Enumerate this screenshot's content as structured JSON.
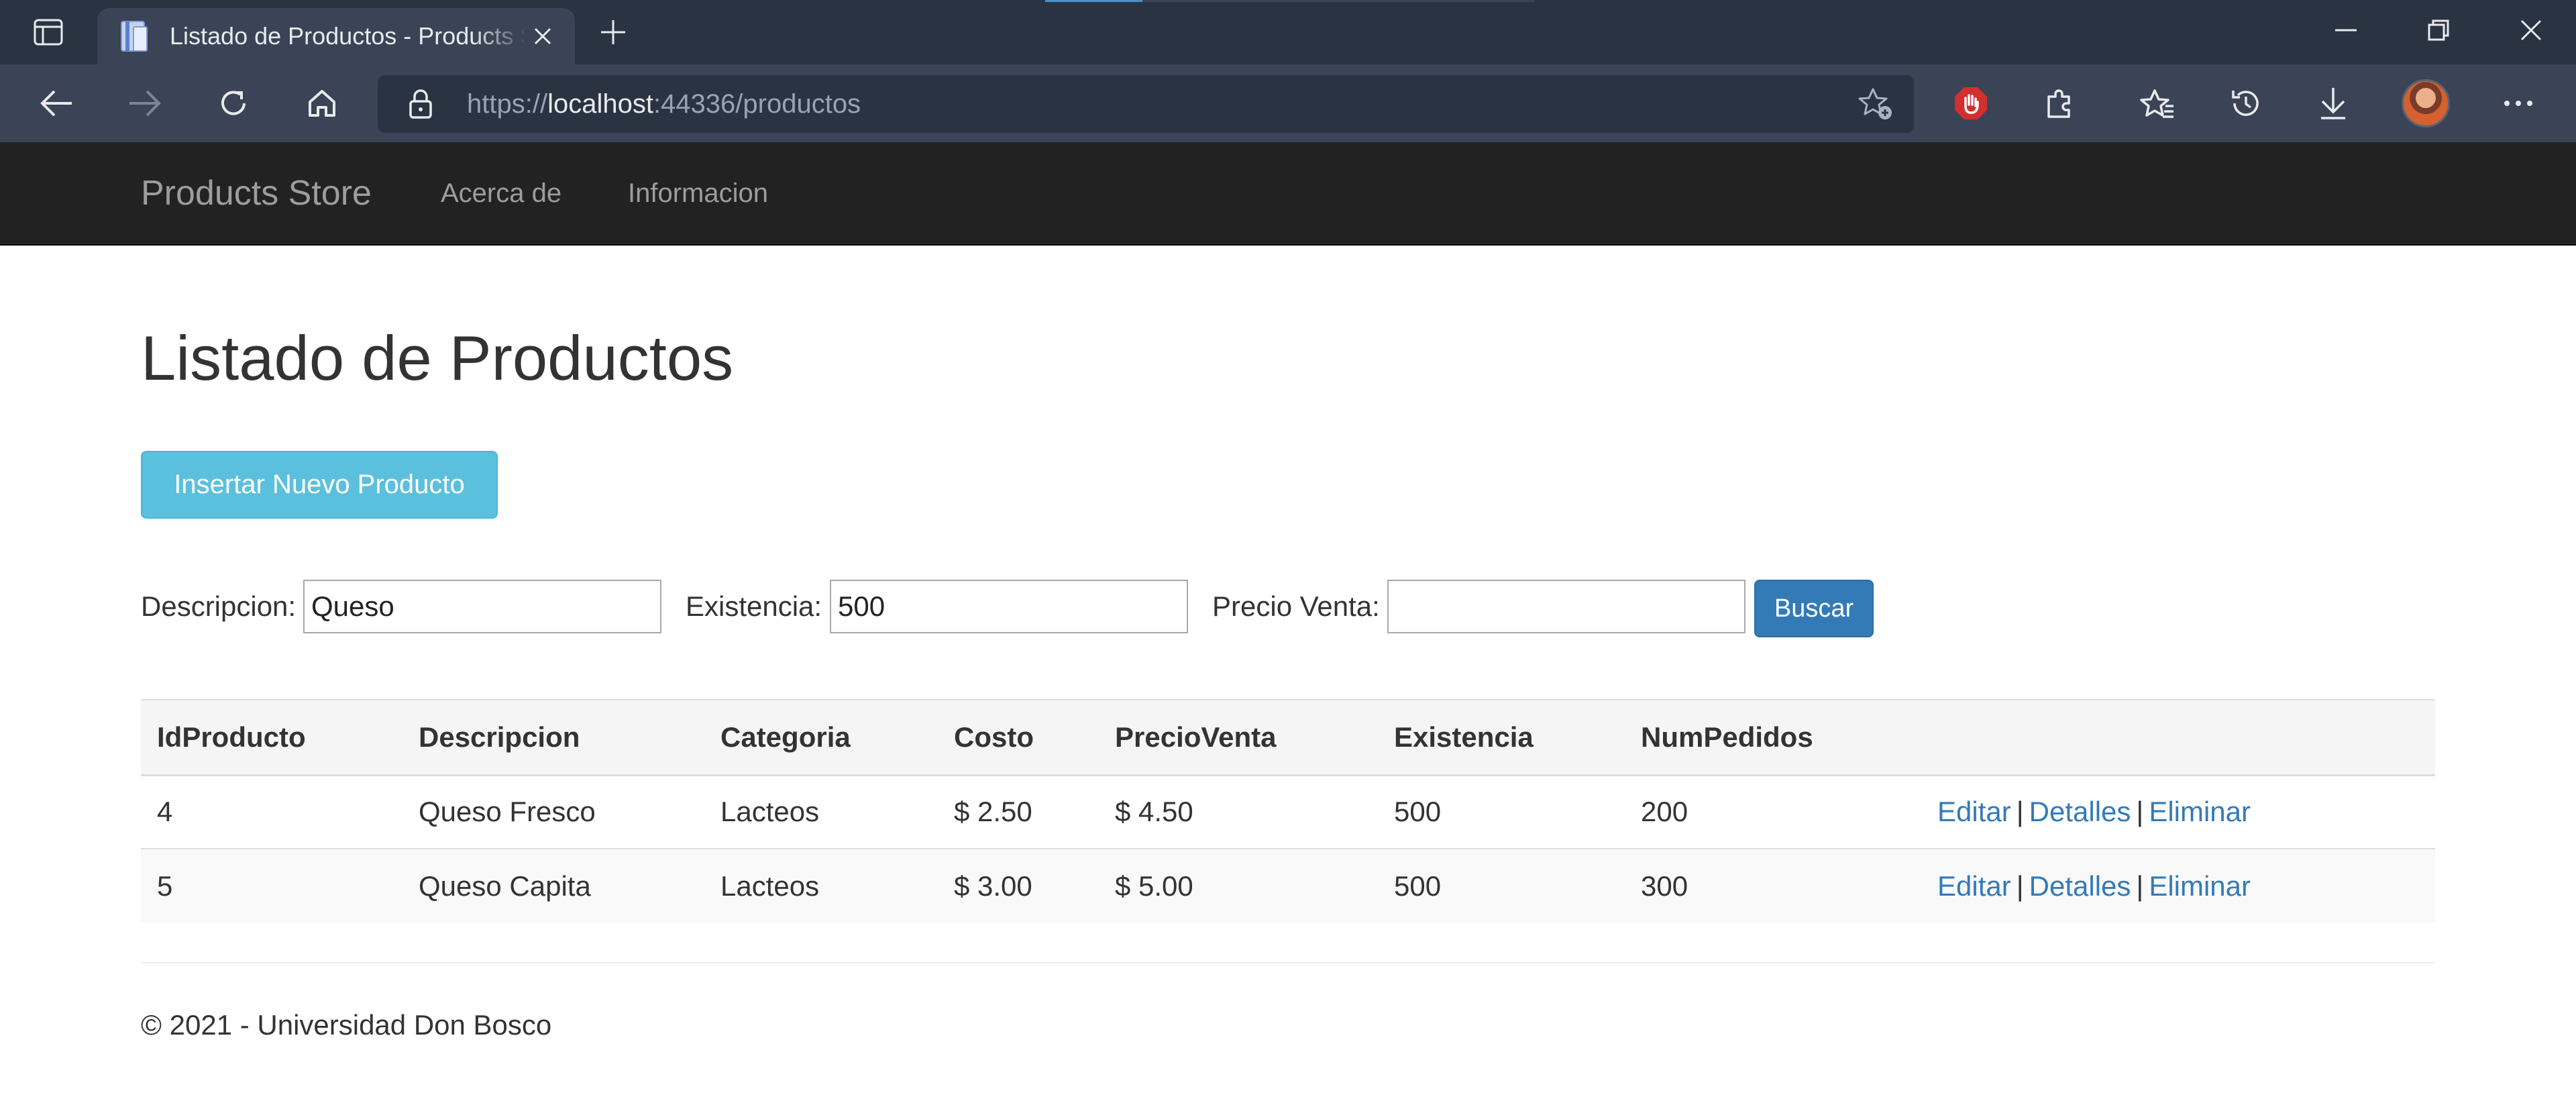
{
  "browser": {
    "tab_title": "Listado de Productos - Products Store",
    "url_scheme": "https://",
    "url_host": "localhost",
    "url_path": ":44336/productos",
    "colors": {
      "chrome_dark": "#2a3342",
      "chrome_light": "#3a4456",
      "adblock_red": "#d32f2f"
    },
    "icons": [
      "tab-actions-icon",
      "favicon-icon",
      "close-icon",
      "plus-icon",
      "minimize-icon",
      "restore-icon",
      "close-window-icon",
      "back-icon",
      "forward-icon",
      "refresh-icon",
      "home-icon",
      "lock-icon",
      "add-favorite-icon",
      "adblock-icon",
      "extensions-icon",
      "favorites-icon",
      "history-icon",
      "download-icon",
      "avatar",
      "more-icon"
    ]
  },
  "navbar": {
    "brand": "Products Store",
    "links": [
      "Acerca de",
      "Informacion"
    ]
  },
  "page": {
    "title": "Listado de Productos",
    "insert_button": "Insertar Nuevo Producto"
  },
  "filters": {
    "descripcion_label": "Descripcion:",
    "descripcion_value": "Queso",
    "existencia_label": "Existencia:",
    "existencia_value": "500",
    "precio_label": "Precio Venta:",
    "precio_value": "",
    "search_button": "Buscar"
  },
  "table": {
    "headers": [
      "IdProducto",
      "Descripcion",
      "Categoria",
      "Costo",
      "PrecioVenta",
      "Existencia",
      "NumPedidos"
    ],
    "rows": [
      {
        "id": "4",
        "descripcion": "Queso Fresco",
        "categoria": "Lacteos",
        "costo": "$ 2.50",
        "precio": "$ 4.50",
        "existencia": "500",
        "pedidos": "200"
      },
      {
        "id": "5",
        "descripcion": "Queso Capita",
        "categoria": "Lacteos",
        "costo": "$ 3.00",
        "precio": "$ 5.00",
        "existencia": "500",
        "pedidos": "300"
      }
    ],
    "actions": {
      "edit": "Editar",
      "details": "Detalles",
      "delete": "Eliminar",
      "separator": "|"
    }
  },
  "footer": {
    "text": "© 2021 - Universidad Don Bosco"
  },
  "colors": {
    "navbar_bg": "#222222",
    "info_button": "#5bc0de",
    "primary_button": "#337ab7",
    "link": "#337ab7"
  }
}
